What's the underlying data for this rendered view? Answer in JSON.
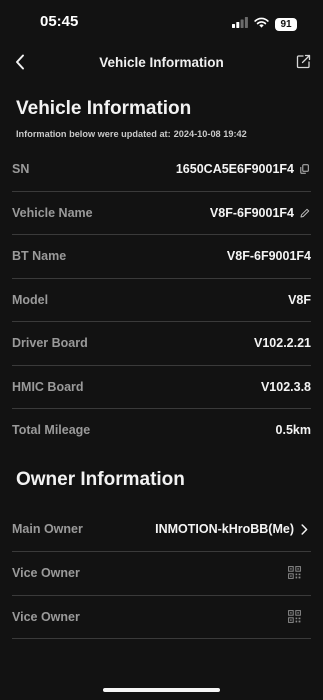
{
  "status_bar": {
    "time": "05:45",
    "battery": "91"
  },
  "nav": {
    "title": "Vehicle Information"
  },
  "vehicle_section": {
    "title": "Vehicle Information",
    "updated_label": "Information below were updated at:",
    "updated_at": "2024-10-08 19:42"
  },
  "vehicle_rows": [
    {
      "label": "SN",
      "value": "1650CA5E6F9001F4"
    },
    {
      "label": "Vehicle Name",
      "value": "V8F-6F9001F4"
    },
    {
      "label": "BT Name",
      "value": "V8F-6F9001F4"
    },
    {
      "label": "Model",
      "value": "V8F"
    },
    {
      "label": "Driver Board",
      "value": "V102.2.21"
    },
    {
      "label": "HMIC Board",
      "value": "V102.3.8"
    },
    {
      "label": "Total Mileage",
      "value": "0.5km"
    }
  ],
  "owner_section": {
    "title": "Owner Information"
  },
  "owner_rows": [
    {
      "label": "Main Owner",
      "value": "INMOTION-kHroBB(Me)"
    },
    {
      "label": "Vice Owner"
    },
    {
      "label": "Vice Owner"
    }
  ],
  "icons": {
    "copy": "copy-icon",
    "edit": "pencil-icon",
    "chevron": "chevron-right-icon",
    "qr": "qr-code-icon",
    "back": "chevron-left-icon",
    "share": "share-icon"
  }
}
